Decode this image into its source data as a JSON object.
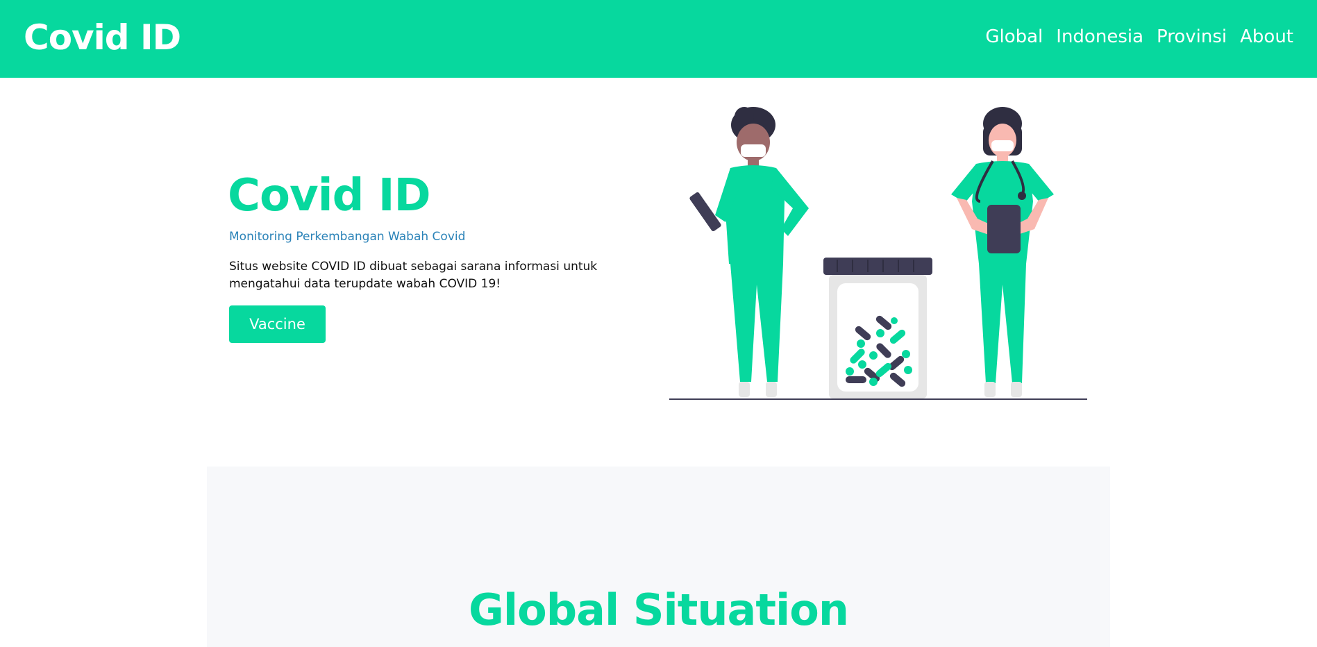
{
  "colors": {
    "accent": "#07d89e",
    "subtitle": "#2b83b8",
    "text": "#111111",
    "section_bg": "#f7f8fa",
    "dark": "#2f2e41"
  },
  "navbar": {
    "brand": "Covid ID",
    "links": [
      "Global",
      "Indonesia",
      "Provinsi",
      "About"
    ]
  },
  "hero": {
    "title": "Covid ID",
    "subtitle": "Monitoring Perkembangan Wabah Covid",
    "description": "Situs website COVID ID dibuat sebagai sarana informasi untuk mengatahui data terupdate wabah COVID 19!",
    "button_label": "Vaccine",
    "illustration_icon": "doctors-with-pill-jar-illustration"
  },
  "global": {
    "title": "Global Situation"
  }
}
